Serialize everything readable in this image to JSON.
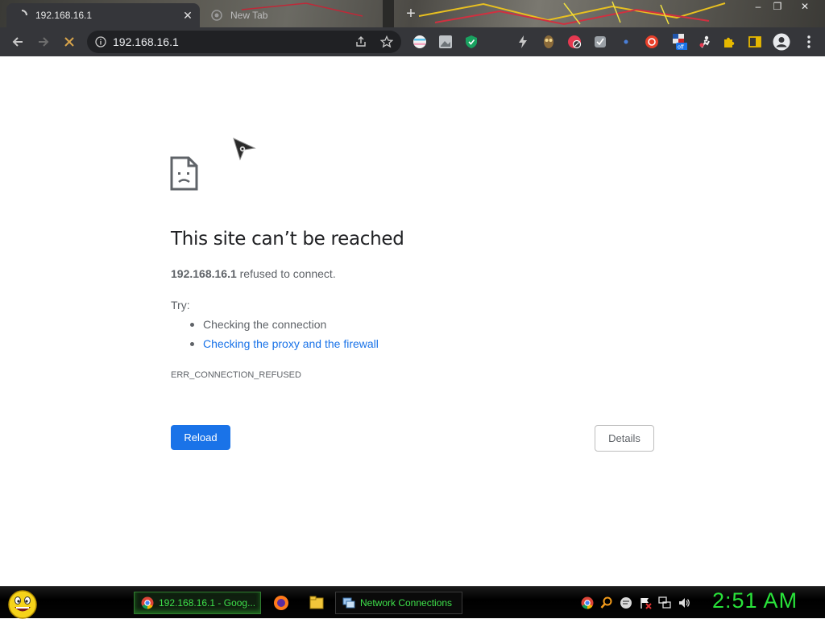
{
  "browser": {
    "tabs": [
      {
        "title": "192.168.16.1",
        "active": true
      },
      {
        "title": "New Tab",
        "active": false
      }
    ],
    "address_bar": {
      "url": "192.168.16.1"
    }
  },
  "error_page": {
    "headline": "This site can’t be reached",
    "summary_host": "192.168.16.1",
    "summary_rest": " refused to connect.",
    "try_label": "Try:",
    "suggestions": [
      {
        "text": "Checking the connection",
        "is_link": false
      },
      {
        "text": "Checking the proxy and the firewall",
        "is_link": true
      }
    ],
    "error_code": "ERR_CONNECTION_REFUSED",
    "reload_label": "Reload",
    "details_label": "Details"
  },
  "taskbar": {
    "tasks": [
      {
        "label": "192.168.16.1 - Goog...",
        "icon": "chrome-icon",
        "active": true
      },
      {
        "label": "Network Connections",
        "icon": "network-connections-icon",
        "active": false
      }
    ],
    "clock": "2:51 AM"
  },
  "colors": {
    "accent": "#1a73e8",
    "taskbar_text": "#3ee04a",
    "clock": "#29e23a"
  }
}
